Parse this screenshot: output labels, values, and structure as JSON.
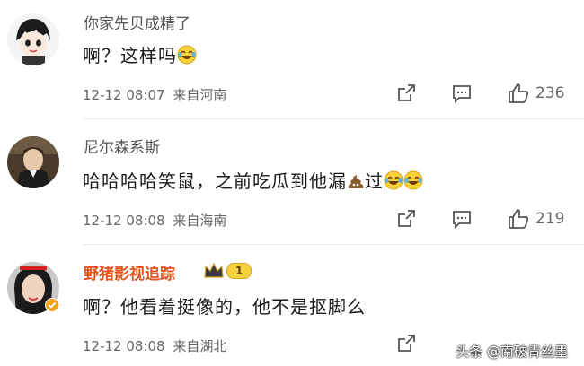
{
  "comments": [
    {
      "username": "你家先贝成精了",
      "text": "啊？这样吗",
      "emoji": "laughing-tears-emoji",
      "timestamp": "12-12 08:07",
      "location": "来自河南",
      "likes": "236"
    },
    {
      "username": "尼尔森系斯",
      "text_before": "哈哈哈哈笑鼠，之前吃瓜到他漏",
      "text_after": "过",
      "emoji": "poop-emoji",
      "trailing_emoji": "laughing-tears-emoji",
      "timestamp": "12-12 08:08",
      "location": "来自海南",
      "likes": "219"
    },
    {
      "username": "野猪影视追踪",
      "badge_level": "1",
      "text": "啊？他看着挺像的，他不是抠脚么",
      "timestamp": "12-12 08:08",
      "location": "来自湖北"
    }
  ],
  "watermark": "头条 @南破青丝墨",
  "colors": {
    "vip_name": "#e0531d",
    "meta": "#666666",
    "badge_gold": "#d4a52a"
  }
}
